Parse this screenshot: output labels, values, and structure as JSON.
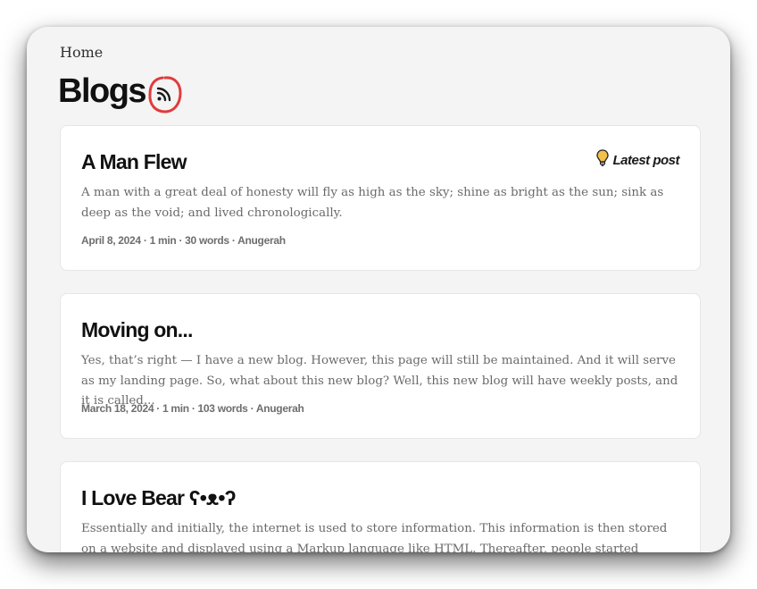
{
  "breadcrumb": {
    "home_label": "Home"
  },
  "page": {
    "title": "Blogs",
    "rss_icon": "rss-feed-icon"
  },
  "posts": [
    {
      "title": "A Man Flew",
      "badge": {
        "label": "Latest post",
        "icon": "lightbulb-icon"
      },
      "excerpt": "A man with a great deal of honesty will fly as high as the sky; shine as bright as the sun; sink as deep as the void; and lived chronologically.",
      "meta": "April 8, 2024 · 1 min · 30 words · Anugerah"
    },
    {
      "title": "Moving on...",
      "excerpt": "Yes, that’s right — I have a new blog. However, this page will still be maintained. And it will serve as my landing page. So, what about this new blog? Well, this new blog will have weekly posts, and it is called...",
      "meta": "March 18, 2024 · 1 min · 103 words · Anugerah"
    },
    {
      "title": "I Love Bear ʕ•ᴥ•ʔ",
      "excerpt": "Essentially and initially, the internet is used to store information. This information is then stored on a website and displayed using a Markup language like HTML. Thereafter, people started writing about a..."
    }
  ],
  "colors": {
    "background": "#f4f4f5",
    "card": "#ffffff",
    "rss_circle": "#e23b3b",
    "lightbulb": "#f4c04a"
  }
}
